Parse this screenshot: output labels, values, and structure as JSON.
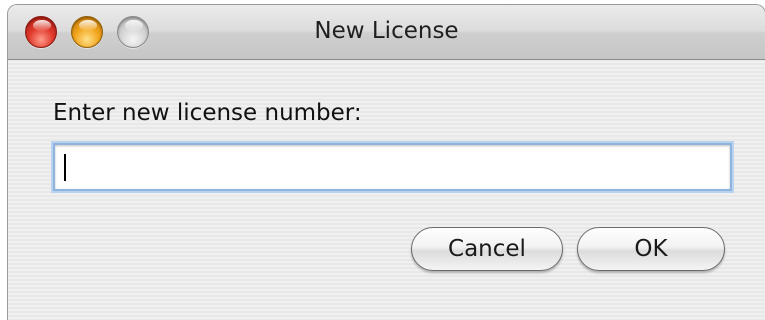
{
  "window": {
    "title": "New License"
  },
  "dialog": {
    "prompt": "Enter new license number:",
    "license_input": {
      "value": "",
      "placeholder": ""
    },
    "cancel_label": "Cancel",
    "ok_label": "OK"
  },
  "icons": {
    "close": "close-traffic-light",
    "minimize": "minimize-traffic-light",
    "zoom": "zoom-traffic-light"
  },
  "colors": {
    "close": "#e0392b",
    "minimize": "#f2a51c",
    "zoom_disabled": "#d2d2d2",
    "focus_ring": "#8fb4e0"
  }
}
